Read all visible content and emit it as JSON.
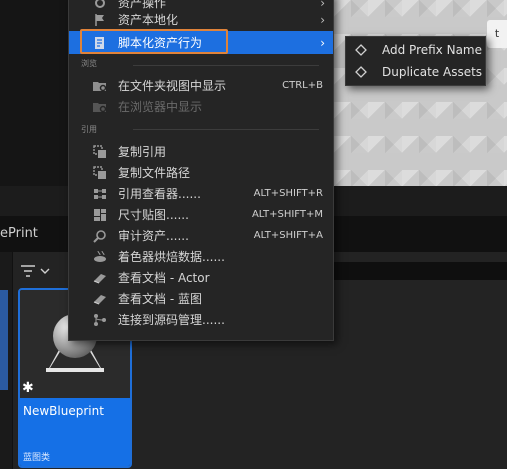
{
  "top_tab": {
    "label": "ePrint"
  },
  "viewport": {
    "right_tab": "t"
  },
  "content_browser": {
    "asset": {
      "name": "NewBlueprint",
      "type": "蓝图类"
    }
  },
  "context_menu": {
    "items_top": [
      {
        "label": "资产操作",
        "icon": "gear-icon",
        "arrow": "›"
      },
      {
        "label": "资产本地化",
        "icon": "flag-icon",
        "arrow": "›"
      },
      {
        "label": "脚本化资产行为",
        "icon": "script-icon",
        "arrow": "›",
        "highlighted": true
      }
    ],
    "section_browse": "浏览",
    "items_browse": [
      {
        "label": "在文件夹视图中显示",
        "icon": "folder-search-icon",
        "shortcut": "CTRL+B"
      },
      {
        "label": "在浏览器中显示",
        "icon": "browser-search-icon",
        "disabled": true
      }
    ],
    "section_ref": "引用",
    "items_ref": [
      {
        "label": "复制引用",
        "icon": "copy-icon"
      },
      {
        "label": "复制文件路径",
        "icon": "copy-path-icon"
      },
      {
        "label": "引用查看器......",
        "icon": "reference-viewer-icon",
        "shortcut": "ALT+SHIFT+R"
      },
      {
        "label": "尺寸贴图......",
        "icon": "size-map-icon",
        "shortcut": "ALT+SHIFT+M"
      },
      {
        "label": "审计资产......",
        "icon": "audit-icon",
        "shortcut": "ALT+SHIFT+A"
      },
      {
        "label": "着色器烘焙数据......",
        "icon": "shader-icon"
      },
      {
        "label": "查看文档 - Actor",
        "icon": "docs-icon"
      },
      {
        "label": "查看文档 - 蓝图",
        "icon": "docs-icon"
      },
      {
        "label": "连接到源码管理......",
        "icon": "source-control-icon"
      }
    ]
  },
  "submenu": {
    "items": [
      {
        "label": "Add Prefix Name",
        "icon": "diamond-icon"
      },
      {
        "label": "Duplicate Assets",
        "icon": "diamond-icon"
      }
    ]
  },
  "colors": {
    "highlight": "#1d6fe0",
    "outline": "#e0833a",
    "asset_band": "#1570e6"
  }
}
